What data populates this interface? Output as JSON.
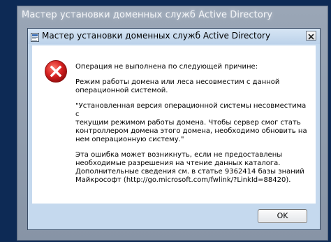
{
  "background_window": {
    "title": "Мастер установки доменных служб Active Directory"
  },
  "dialog": {
    "title": "Мастер установки доменных служб Active Directory",
    "icon": "ad-wizard-icon",
    "close_icon": "close-icon",
    "error_icon": "error-icon",
    "messages": [
      "Операция не выполнена по следующей причине:",
      "Режим работы домена или леса несовместим с данной\nоперационной системой.",
      "\"Установленная версия операционной системы несовместима с\nтекущим режимом работы домена. Чтобы сервер смог стать\nконтроллером домена этого домена, необходимо обновить на\nнем операционную систему.\"",
      "Эта ошибка может возникнуть, если не предоставлены\nнеобходимые разрешения на чтение данных каталога.\nДополнительные сведения см. в статье 9362414 базы знаний\nМайкрософт (http://go.microsoft.com/fwlink/?LinkId=88420)."
    ],
    "ok_label": "OK"
  },
  "colors": {
    "desktop": "#0d2a55",
    "dialog_frame": "#c5d9ee",
    "error_red": "#d42020"
  }
}
